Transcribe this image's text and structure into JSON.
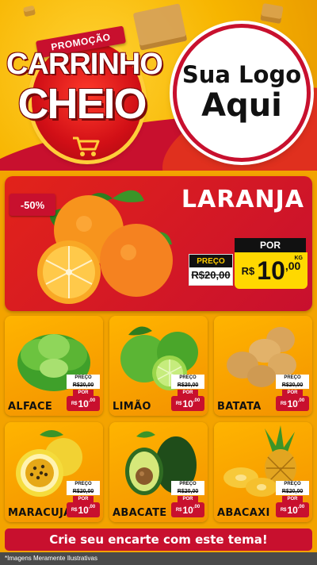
{
  "header": {
    "seal_ribbon": "PROMOÇÃO",
    "seal_line1": "CARRINHO",
    "seal_line2": "CHEIO",
    "logo_line1": "Sua Logo",
    "logo_line2": "Aqui"
  },
  "featured": {
    "discount_badge": "-50%",
    "name": "LARANJA",
    "old_label": "PREÇO",
    "old_price": "R$20,00",
    "new_label": "POR",
    "currency": "R$",
    "price_int": "10",
    "price_cents": ",00",
    "unit": "KG"
  },
  "products": [
    {
      "name": "ALFACE",
      "old_label": "PREÇO",
      "old_price": "R$20,00",
      "new_label": "POR",
      "currency": "R$",
      "price_int": "10",
      "price_cents": ",00"
    },
    {
      "name": "LIMÃO",
      "old_label": "PREÇO",
      "old_price": "R$20,00",
      "new_label": "POR",
      "currency": "R$",
      "price_int": "10",
      "price_cents": ",00"
    },
    {
      "name": "BATATA",
      "old_label": "PREÇO",
      "old_price": "R$20,00",
      "new_label": "POR",
      "currency": "R$",
      "price_int": "10",
      "price_cents": ",00"
    },
    {
      "name": "MARACUJÁ",
      "old_label": "PREÇO",
      "old_price": "R$20,00",
      "new_label": "POR",
      "currency": "R$",
      "price_int": "10",
      "price_cents": ",00"
    },
    {
      "name": "ABACATE",
      "old_label": "PREÇO",
      "old_price": "R$20,00",
      "new_label": "POR",
      "currency": "R$",
      "price_int": "10",
      "price_cents": ",00"
    },
    {
      "name": "ABACAXI",
      "old_label": "PREÇO",
      "old_price": "R$20,00",
      "new_label": "POR",
      "currency": "R$",
      "price_int": "10",
      "price_cents": ",00"
    }
  ],
  "cta": "Crie seu encarte com este tema!",
  "disclaimer": "*Imagens Meramente Ilustrativas",
  "colors": {
    "brand_red": "#c8102e",
    "brand_yellow": "#ffd800",
    "brand_orange": "#f39200"
  }
}
